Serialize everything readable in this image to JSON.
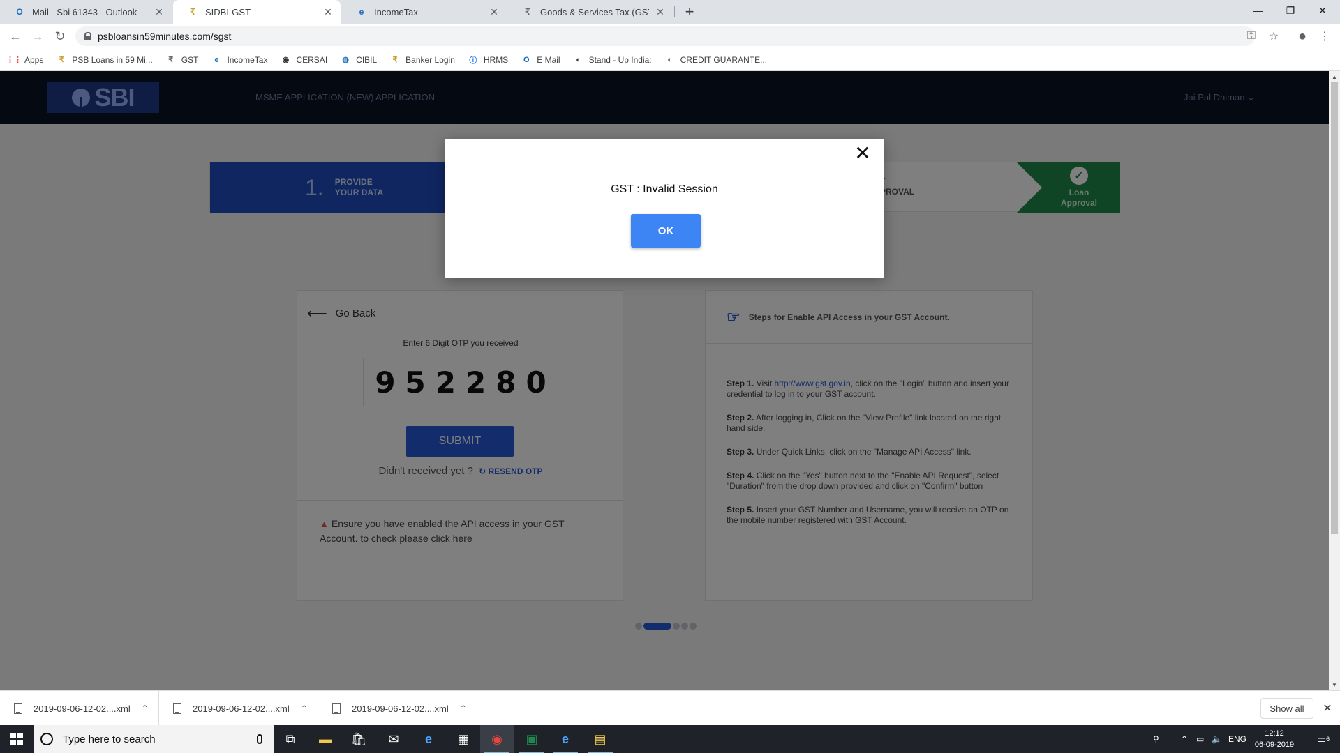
{
  "browser": {
    "tabs": [
      {
        "title": "Mail - Sbi 61343 - Outlook",
        "icon": "outlook-icon",
        "icon_color": "#0f6cbd"
      },
      {
        "title": "SIDBI-GST",
        "icon": "gst-icon",
        "icon_color": "#c8a030"
      },
      {
        "title": "IncomeTax",
        "icon": "ie-icon",
        "icon_color": "#1e6fc2"
      },
      {
        "title": "Goods & Services Tax (GST) | User",
        "icon": "gst-icon",
        "icon_color": "#6a6a6a"
      }
    ],
    "new_tab": "+",
    "url": "psbloansin59minutes.com/sgst",
    "bookmarks": [
      {
        "label": "Apps",
        "icon": "apps-grid-icon"
      },
      {
        "label": "PSB Loans in 59 Mi...",
        "icon": "psb-icon"
      },
      {
        "label": "GST",
        "icon": "gst-icon"
      },
      {
        "label": "IncomeTax",
        "icon": "ie-icon"
      },
      {
        "label": "CERSAI",
        "icon": "cersai-icon"
      },
      {
        "label": "CIBIL",
        "icon": "cibil-icon"
      },
      {
        "label": "Banker Login",
        "icon": "psb-icon"
      },
      {
        "label": "HRMS",
        "icon": "hrms-icon"
      },
      {
        "label": "E Mail",
        "icon": "outlook-icon"
      },
      {
        "label": "Stand - Up India:",
        "icon": "globe-icon"
      },
      {
        "label": "CREDIT GUARANTE...",
        "icon": "globe-icon"
      }
    ]
  },
  "site": {
    "logo_text": "SBI",
    "nav": [
      "MSME APPLICATION (NEW)",
      "APPLICATION"
    ],
    "user": "Jai Pal Dhiman",
    "steps": {
      "first_number": "1.",
      "first_label_1": "PROVIDE",
      "first_label_2": "YOUR DATA",
      "mid_label_1": "T",
      "mid_label_2": "PROVAL",
      "final_label_1": "Loan",
      "final_label_2": "Approval"
    },
    "otp_card": {
      "go_back": "Go Back",
      "otp_label": "Enter 6 Digit OTP you received",
      "otp_value": "952280",
      "submit": "SUBMIT",
      "resend_prompt": "Didn't received yet ?",
      "resend_link": "RESEND OTP",
      "api_note": "Ensure you have enabled the API access in your GST Account. to check please click here"
    },
    "api_card": {
      "title": "Steps for Enable API Access in your GST Account.",
      "steps": [
        {
          "label": "Step 1.",
          "pre": " Visit ",
          "link": "http://www.gst.gov.in",
          "post": ", click on the \"Login\" button and insert your credential to log in to your GST account."
        },
        {
          "label": "Step 2.",
          "pre": " After logging in, Click on the \"View Profile\" link located on the right hand side.",
          "link": "",
          "post": ""
        },
        {
          "label": "Step 3.",
          "pre": " Under Quick Links, click on the \"Manage API Access\" link.",
          "link": "",
          "post": ""
        },
        {
          "label": "Step 4.",
          "pre": " Click on the \"Yes\" button next to the \"Enable API Request\", select \"Duration\" from the drop down provided and click on \"Confirm\" button",
          "link": "",
          "post": ""
        },
        {
          "label": "Step 5.",
          "pre": " Insert your GST Number and Username, you will receive an OTP on the mobile number registered with GST Account.",
          "link": "",
          "post": ""
        }
      ]
    }
  },
  "modal": {
    "title": "GST : Invalid Session",
    "ok": "OK",
    "close": "✕"
  },
  "downloads": {
    "items": [
      "2019-09-06-12-02....xml",
      "2019-09-06-12-02....xml",
      "2019-09-06-12-02....xml"
    ],
    "show_all": "Show all"
  },
  "taskbar": {
    "search_placeholder": "Type here to search",
    "language": "ENG",
    "time": "12:12",
    "date": "06-09-2019",
    "notifications": "6"
  },
  "colors": {
    "sbi_blue": "#1e4cc0",
    "modal_ok": "#3d85f5",
    "approval_green": "#1e8a4a"
  }
}
